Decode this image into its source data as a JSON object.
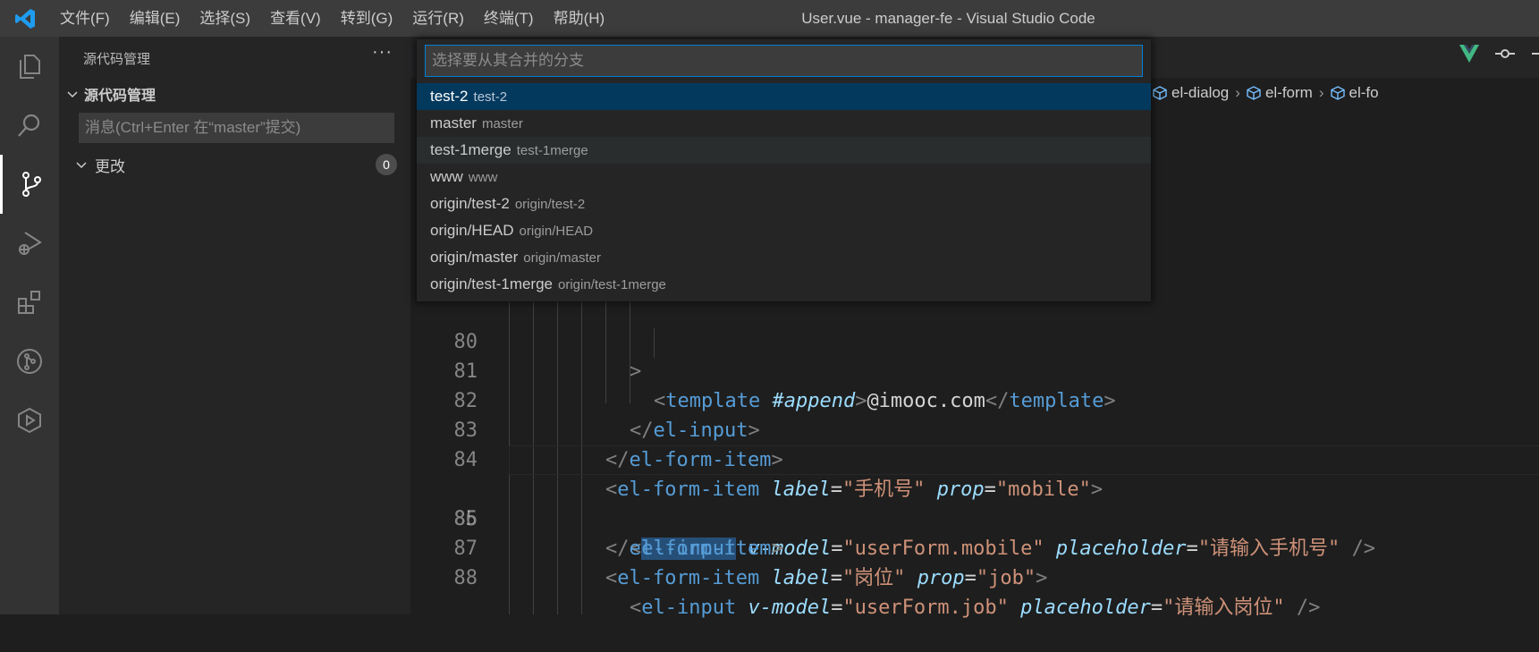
{
  "window": {
    "title": "User.vue - manager-fe - Visual Studio Code"
  },
  "menu": [
    "文件(F)",
    "编辑(E)",
    "选择(S)",
    "查看(V)",
    "转到(G)",
    "运行(R)",
    "终端(T)",
    "帮助(H)"
  ],
  "sidebar": {
    "header": "源代码管理",
    "more": "···",
    "section": "源代码管理",
    "commit_placeholder": "消息(Ctrl+Enter 在“master”提交)",
    "changes_label": "更改",
    "changes_count": "0"
  },
  "breadcrumb": [
    "el-dialog",
    "el-form",
    "el-fo"
  ],
  "quick_pick": {
    "placeholder": "选择要从其合并的分支",
    "items": [
      {
        "label": "test-2",
        "description": "test-2"
      },
      {
        "label": "master",
        "description": "master"
      },
      {
        "label": "test-1merge",
        "description": "test-1merge"
      },
      {
        "label": "www",
        "description": "www"
      },
      {
        "label": "origin/test-2",
        "description": "origin/test-2"
      },
      {
        "label": "origin/HEAD",
        "description": "origin/HEAD"
      },
      {
        "label": "origin/master",
        "description": "origin/master"
      },
      {
        "label": "origin/test-1merge",
        "description": "origin/test-1merge"
      }
    ]
  },
  "code": {
    "line_numbers": [
      "80",
      "81",
      "82",
      "83",
      "84",
      "85",
      "86",
      "87",
      "88"
    ],
    "current_line": "85",
    "l80": {
      "close": ">"
    },
    "l81": {
      "lt": "<",
      "tag": "template",
      "attr": "#append",
      "gt": ">",
      "text": "@imooc.com",
      "lt2": "</",
      "tag2": "template",
      "gt2": ">"
    },
    "l82": {
      "lt": "</",
      "tag": "el-input",
      "gt": ">"
    },
    "l83": {
      "lt": "</",
      "tag": "el-form-item",
      "gt": ">"
    },
    "l84": {
      "lt": "<",
      "tag": "el-form-item",
      "a1": "label",
      "eq1": "=",
      "v1": "\"手机号\"",
      "a2": "prop",
      "eq2": "=",
      "v2": "\"mobile\"",
      "gt": ">"
    },
    "l85": {
      "lt": "<",
      "tag": "el-input",
      "a1": "v-model",
      "eq1": "=",
      "v1": "\"userForm.mobile\"",
      "a2": "placeholder",
      "eq2": "=",
      "v2": "\"请输入手机号\"",
      "gt": "/>"
    },
    "l86": {
      "lt": "</",
      "tag": "el-form-item",
      "gt": ">"
    },
    "l87": {
      "lt": "<",
      "tag": "el-form-item",
      "a1": "label",
      "eq1": "=",
      "v1": "\"岗位\"",
      "a2": "prop",
      "eq2": "=",
      "v2": "\"job\"",
      "gt": ">"
    },
    "l88": {
      "lt": "<",
      "tag": "el-input",
      "a1": "v-model",
      "eq1": "=",
      "v1": "\"userForm.job\"",
      "a2": "placeholder",
      "eq2": "=",
      "v2": "\"请输入岗位\"",
      "gt": "/>"
    }
  },
  "icons": {
    "activity": [
      "explorer-icon",
      "search-icon",
      "source-control-icon",
      "run-debug-icon",
      "extensions-icon",
      "git-graph-icon",
      "remote-icon"
    ]
  },
  "colors": {
    "accent": "#007fd4",
    "selection": "#04395e"
  }
}
